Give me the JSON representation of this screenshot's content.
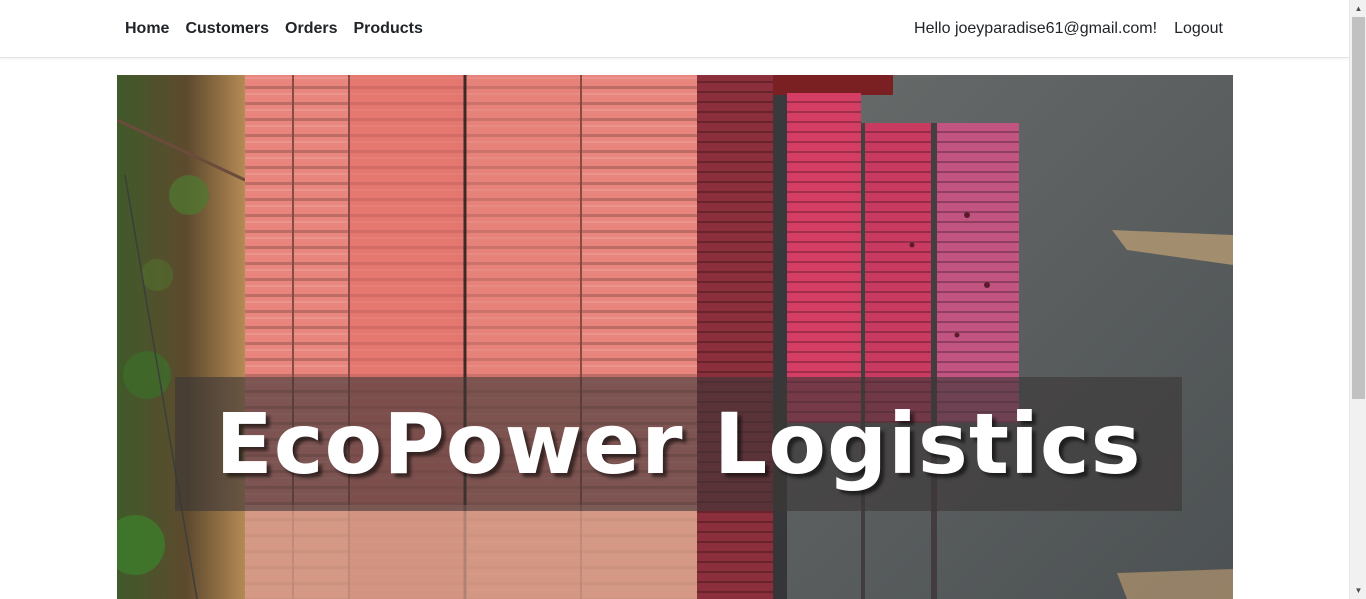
{
  "nav": {
    "links": [
      "Home",
      "Customers",
      "Orders",
      "Products"
    ],
    "greeting": "Hello joeyparadise61@gmail.com!",
    "logout": "Logout"
  },
  "hero": {
    "title": "EcoPower Logistics"
  },
  "icons": {
    "scroll_up": "scroll-up-arrow-icon",
    "scroll_down": "scroll-down-arrow-icon"
  },
  "colors": {
    "nav_text": "#212529",
    "title_text": "#ffffff",
    "title_band": "rgba(60,55,55,0.62)"
  }
}
